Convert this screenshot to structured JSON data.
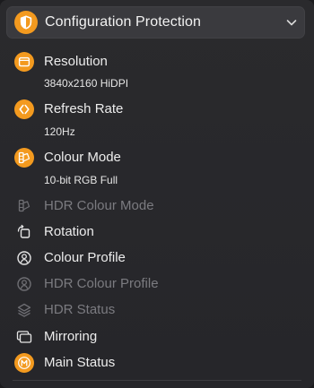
{
  "header": {
    "title": "Configuration Protection",
    "icon": "shield-icon",
    "chevron": "chevron-down-icon"
  },
  "colors": {
    "accent": "#f39a1f",
    "text": "#ececec",
    "dim_text": "#7b7b80",
    "panel_bg": "#29292c",
    "header_bg": "#3a3a3e"
  },
  "items": [
    {
      "id": "resolution",
      "label": "Resolution",
      "value": "3840x2160 HiDPI",
      "icon": "display-frame-icon",
      "enabled": true
    },
    {
      "id": "refresh-rate",
      "label": "Refresh Rate",
      "value": "120Hz",
      "icon": "refresh-rate-icon",
      "enabled": true
    },
    {
      "id": "colour-mode",
      "label": "Colour Mode",
      "value": "10-bit RGB Full",
      "icon": "colour-mode-icon",
      "enabled": true
    },
    {
      "id": "hdr-colour-mode",
      "label": "HDR Colour Mode",
      "icon": "colour-mode-icon",
      "enabled": false
    },
    {
      "id": "rotation",
      "label": "Rotation",
      "icon": "rotation-icon",
      "enabled": true
    },
    {
      "id": "colour-profile",
      "label": "Colour Profile",
      "icon": "colour-profile-icon",
      "enabled": true
    },
    {
      "id": "hdr-colour-profile",
      "label": "HDR Colour Profile",
      "icon": "colour-profile-icon",
      "enabled": false
    },
    {
      "id": "hdr-status",
      "label": "HDR Status",
      "icon": "layers-icon",
      "enabled": false
    },
    {
      "id": "mirroring",
      "label": "Mirroring",
      "icon": "mirroring-icon",
      "enabled": true
    },
    {
      "id": "main-status",
      "label": "Main Status",
      "icon": "main-status-icon",
      "enabled": true
    }
  ]
}
